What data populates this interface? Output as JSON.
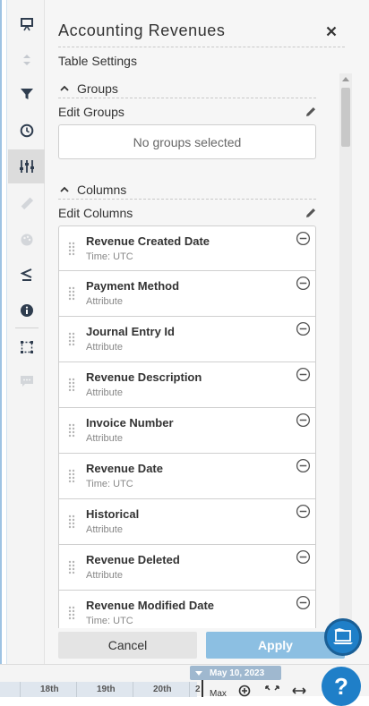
{
  "panel": {
    "title": "Accounting Revenues",
    "subtitle": "Table Settings"
  },
  "groups": {
    "section_label": "Groups",
    "edit_label": "Edit Groups",
    "empty_text": "No groups selected"
  },
  "columns": {
    "section_label": "Columns",
    "edit_label": "Edit Columns",
    "items": [
      {
        "name": "Revenue Created Date",
        "type": "Time: UTC"
      },
      {
        "name": "Payment Method",
        "type": "Attribute"
      },
      {
        "name": "Journal Entry Id",
        "type": "Attribute"
      },
      {
        "name": "Revenue Description",
        "type": "Attribute"
      },
      {
        "name": "Invoice Number",
        "type": "Attribute"
      },
      {
        "name": "Revenue Date",
        "type": "Time: UTC"
      },
      {
        "name": "Historical",
        "type": "Attribute"
      },
      {
        "name": "Revenue Deleted",
        "type": "Attribute"
      },
      {
        "name": "Revenue Modified Date",
        "type": "Time: UTC"
      }
    ]
  },
  "actions": {
    "cancel": "Cancel",
    "apply": "Apply"
  },
  "timeline": {
    "labels": [
      "18th",
      "19th",
      "20th",
      "2"
    ],
    "current_date": "May 10, 2023",
    "max_label": "Max"
  },
  "help": {
    "label": "?"
  },
  "colors": {
    "accent": "#1f7fc8",
    "apply_button": "#8cbfe2",
    "panel_bg": "#f6f6f6"
  },
  "toolbar_icons": [
    "presentation-icon",
    "sort-icon",
    "filter-icon",
    "clock-icon",
    "sliders-icon",
    "ruler-icon",
    "palette-icon",
    "less-equal-icon",
    "info-icon",
    "selection-icon",
    "comment-icon"
  ]
}
